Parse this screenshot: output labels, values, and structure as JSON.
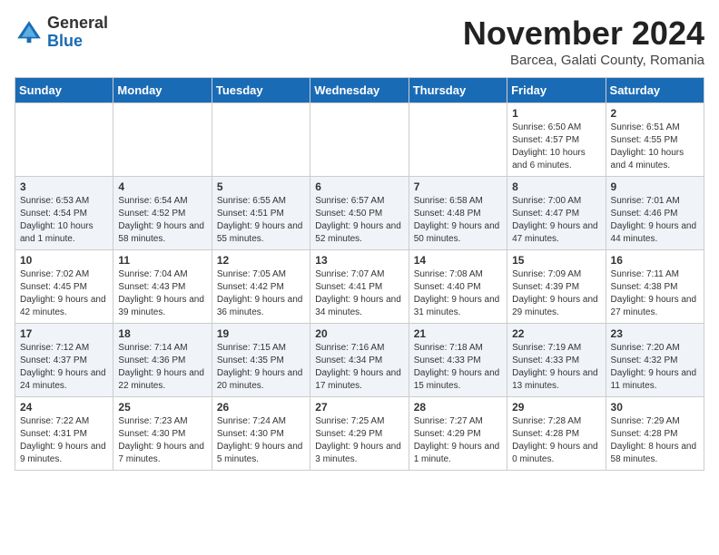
{
  "header": {
    "logo_general": "General",
    "logo_blue": "Blue",
    "month_title": "November 2024",
    "location": "Barcea, Galati County, Romania"
  },
  "days_of_week": [
    "Sunday",
    "Monday",
    "Tuesday",
    "Wednesday",
    "Thursday",
    "Friday",
    "Saturday"
  ],
  "weeks": [
    [
      {
        "day": "",
        "info": ""
      },
      {
        "day": "",
        "info": ""
      },
      {
        "day": "",
        "info": ""
      },
      {
        "day": "",
        "info": ""
      },
      {
        "day": "",
        "info": ""
      },
      {
        "day": "1",
        "info": "Sunrise: 6:50 AM\nSunset: 4:57 PM\nDaylight: 10 hours and 6 minutes."
      },
      {
        "day": "2",
        "info": "Sunrise: 6:51 AM\nSunset: 4:55 PM\nDaylight: 10 hours and 4 minutes."
      }
    ],
    [
      {
        "day": "3",
        "info": "Sunrise: 6:53 AM\nSunset: 4:54 PM\nDaylight: 10 hours and 1 minute."
      },
      {
        "day": "4",
        "info": "Sunrise: 6:54 AM\nSunset: 4:52 PM\nDaylight: 9 hours and 58 minutes."
      },
      {
        "day": "5",
        "info": "Sunrise: 6:55 AM\nSunset: 4:51 PM\nDaylight: 9 hours and 55 minutes."
      },
      {
        "day": "6",
        "info": "Sunrise: 6:57 AM\nSunset: 4:50 PM\nDaylight: 9 hours and 52 minutes."
      },
      {
        "day": "7",
        "info": "Sunrise: 6:58 AM\nSunset: 4:48 PM\nDaylight: 9 hours and 50 minutes."
      },
      {
        "day": "8",
        "info": "Sunrise: 7:00 AM\nSunset: 4:47 PM\nDaylight: 9 hours and 47 minutes."
      },
      {
        "day": "9",
        "info": "Sunrise: 7:01 AM\nSunset: 4:46 PM\nDaylight: 9 hours and 44 minutes."
      }
    ],
    [
      {
        "day": "10",
        "info": "Sunrise: 7:02 AM\nSunset: 4:45 PM\nDaylight: 9 hours and 42 minutes."
      },
      {
        "day": "11",
        "info": "Sunrise: 7:04 AM\nSunset: 4:43 PM\nDaylight: 9 hours and 39 minutes."
      },
      {
        "day": "12",
        "info": "Sunrise: 7:05 AM\nSunset: 4:42 PM\nDaylight: 9 hours and 36 minutes."
      },
      {
        "day": "13",
        "info": "Sunrise: 7:07 AM\nSunset: 4:41 PM\nDaylight: 9 hours and 34 minutes."
      },
      {
        "day": "14",
        "info": "Sunrise: 7:08 AM\nSunset: 4:40 PM\nDaylight: 9 hours and 31 minutes."
      },
      {
        "day": "15",
        "info": "Sunrise: 7:09 AM\nSunset: 4:39 PM\nDaylight: 9 hours and 29 minutes."
      },
      {
        "day": "16",
        "info": "Sunrise: 7:11 AM\nSunset: 4:38 PM\nDaylight: 9 hours and 27 minutes."
      }
    ],
    [
      {
        "day": "17",
        "info": "Sunrise: 7:12 AM\nSunset: 4:37 PM\nDaylight: 9 hours and 24 minutes."
      },
      {
        "day": "18",
        "info": "Sunrise: 7:14 AM\nSunset: 4:36 PM\nDaylight: 9 hours and 22 minutes."
      },
      {
        "day": "19",
        "info": "Sunrise: 7:15 AM\nSunset: 4:35 PM\nDaylight: 9 hours and 20 minutes."
      },
      {
        "day": "20",
        "info": "Sunrise: 7:16 AM\nSunset: 4:34 PM\nDaylight: 9 hours and 17 minutes."
      },
      {
        "day": "21",
        "info": "Sunrise: 7:18 AM\nSunset: 4:33 PM\nDaylight: 9 hours and 15 minutes."
      },
      {
        "day": "22",
        "info": "Sunrise: 7:19 AM\nSunset: 4:33 PM\nDaylight: 9 hours and 13 minutes."
      },
      {
        "day": "23",
        "info": "Sunrise: 7:20 AM\nSunset: 4:32 PM\nDaylight: 9 hours and 11 minutes."
      }
    ],
    [
      {
        "day": "24",
        "info": "Sunrise: 7:22 AM\nSunset: 4:31 PM\nDaylight: 9 hours and 9 minutes."
      },
      {
        "day": "25",
        "info": "Sunrise: 7:23 AM\nSunset: 4:30 PM\nDaylight: 9 hours and 7 minutes."
      },
      {
        "day": "26",
        "info": "Sunrise: 7:24 AM\nSunset: 4:30 PM\nDaylight: 9 hours and 5 minutes."
      },
      {
        "day": "27",
        "info": "Sunrise: 7:25 AM\nSunset: 4:29 PM\nDaylight: 9 hours and 3 minutes."
      },
      {
        "day": "28",
        "info": "Sunrise: 7:27 AM\nSunset: 4:29 PM\nDaylight: 9 hours and 1 minute."
      },
      {
        "day": "29",
        "info": "Sunrise: 7:28 AM\nSunset: 4:28 PM\nDaylight: 9 hours and 0 minutes."
      },
      {
        "day": "30",
        "info": "Sunrise: 7:29 AM\nSunset: 4:28 PM\nDaylight: 8 hours and 58 minutes."
      }
    ]
  ]
}
